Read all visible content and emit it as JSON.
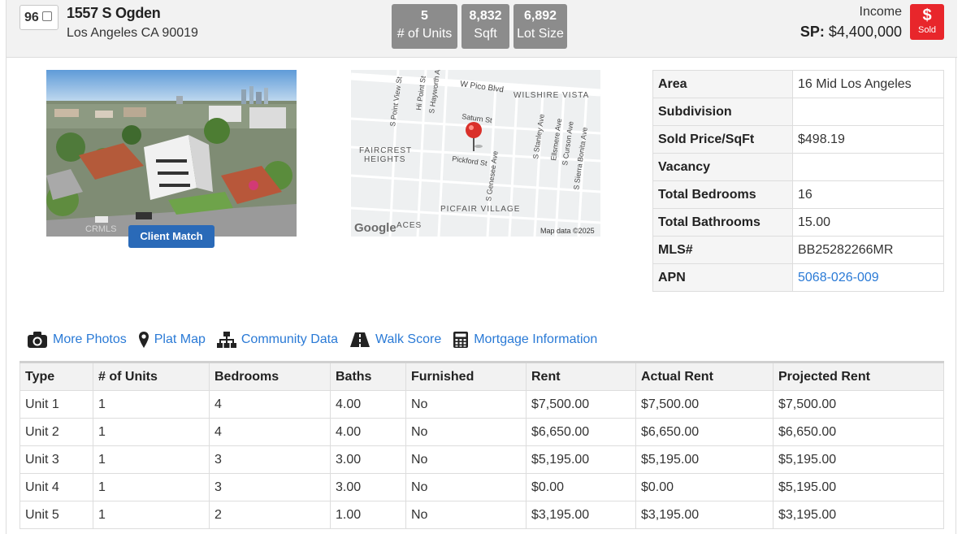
{
  "header": {
    "list_number": "96",
    "address_line1": "1557 S Ogden",
    "address_line2": "Los Angeles CA 90019",
    "stats": [
      {
        "value": "5",
        "label": "# of Units"
      },
      {
        "value": "8,832",
        "label": "Sqft"
      },
      {
        "value": "6,892",
        "label": "Lot Size"
      }
    ],
    "property_type": "Income",
    "sp_label": "SP:",
    "sp_value": "$4,400,000",
    "badge_symbol": "$",
    "badge_label": "Sold"
  },
  "photo": {
    "watermark": "CRMLS",
    "client_match_label": "Client Match"
  },
  "map": {
    "labels": {
      "pico": "W Pico Blvd",
      "wilshire": "WILSHIRE VISTA",
      "faircrest1": "FAIRCREST",
      "faircrest2": "HEIGHTS",
      "picfair": "PICFAIR VILLAGE",
      "saturn": "Saturn St",
      "pickford": "Pickford St",
      "spointview": "S Point View St",
      "hipoint": "Hi Point St",
      "hayworth": "S Hayworth Ave",
      "genesee": "S Genesee Ave",
      "stanley": "S Stanley Ave",
      "ellsmere": "Ellsmere Ave",
      "curson": "S Curson Ave",
      "sierra": "S Sierra Bonita Ave",
      "aces": "ACES",
      "google": "Google",
      "mapdata": "Map data ©2025"
    }
  },
  "info": [
    {
      "key": "Area",
      "value": "16 Mid Los Angeles"
    },
    {
      "key": "Subdivision",
      "value": ""
    },
    {
      "key": "Sold Price/SqFt",
      "value": "$498.19"
    },
    {
      "key": "Vacancy",
      "value": ""
    },
    {
      "key": "Total Bedrooms",
      "value": "16"
    },
    {
      "key": "Total Bathrooms",
      "value": "15.00"
    },
    {
      "key": "MLS#",
      "value": "BB25282266MR"
    },
    {
      "key": "APN",
      "value": "5068-026-009"
    }
  ],
  "links": [
    {
      "label": "More Photos",
      "icon": "camera-icon"
    },
    {
      "label": "Plat Map",
      "icon": "map-pin-icon"
    },
    {
      "label": "Community Data",
      "icon": "sitemap-icon"
    },
    {
      "label": "Walk Score",
      "icon": "road-icon"
    },
    {
      "label": "Mortgage Information",
      "icon": "calculator-icon"
    }
  ],
  "units_table": {
    "headers": [
      "Type",
      "# of Units",
      "Bedrooms",
      "Baths",
      "Furnished",
      "Rent",
      "Actual Rent",
      "Projected Rent"
    ],
    "rows": [
      [
        "Unit 1",
        "1",
        "4",
        "4.00",
        "No",
        "$7,500.00",
        "$7,500.00",
        "$7,500.00"
      ],
      [
        "Unit 2",
        "1",
        "4",
        "4.00",
        "No",
        "$6,650.00",
        "$6,650.00",
        "$6,650.00"
      ],
      [
        "Unit 3",
        "1",
        "3",
        "3.00",
        "No",
        "$5,195.00",
        "$5,195.00",
        "$5,195.00"
      ],
      [
        "Unit 4",
        "1",
        "3",
        "3.00",
        "No",
        "$0.00",
        "$0.00",
        "$5,195.00"
      ],
      [
        "Unit 5",
        "1",
        "2",
        "1.00",
        "No",
        "$3,195.00",
        "$3,195.00",
        "$3,195.00"
      ]
    ]
  }
}
